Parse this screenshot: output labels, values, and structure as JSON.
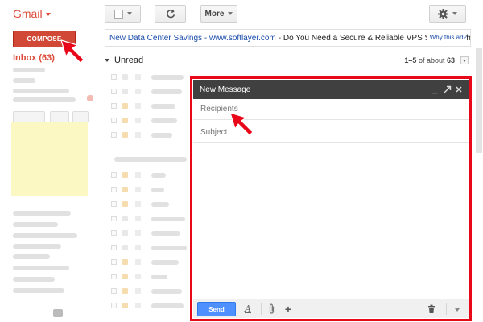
{
  "app": {
    "name": "Gmail"
  },
  "toolbar": {
    "more_label": "More",
    "refresh_icon": "refresh-icon",
    "settings_icon": "gear-icon"
  },
  "sidebar": {
    "compose_label": "COMPOSE",
    "inbox_label": "Inbox (63)"
  },
  "ad": {
    "link": "New Data Center Savings - www.softlayer.com",
    "text": "- Do You Need a Secure & Reliable VPS Solution? Ch",
    "why": "Why this ad?"
  },
  "mail_list": {
    "section": "Unread",
    "count_prefix": "1–5",
    "count_suffix": " of about ",
    "count_total": "63"
  },
  "compose_window": {
    "title": "New Message",
    "recipients_placeholder": "Recipients",
    "subject_placeholder": "Subject",
    "send_label": "Send"
  },
  "colors": {
    "brand_red": "#dd4b39",
    "compose_red": "#d14836",
    "send_blue": "#4d90fe",
    "highlight_red": "#e8081a"
  }
}
